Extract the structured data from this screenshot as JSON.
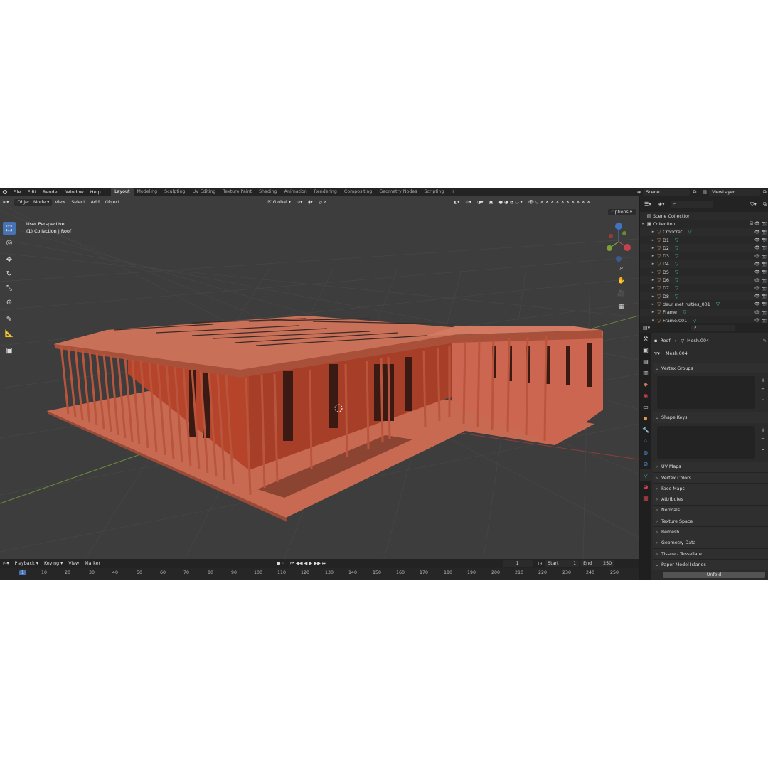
{
  "topbar": {
    "menu": [
      "File",
      "Edit",
      "Render",
      "Window",
      "Help"
    ],
    "workspace_tabs": [
      "Layout",
      "Modeling",
      "Sculpting",
      "UV Editing",
      "Texture Paint",
      "Shading",
      "Animation",
      "Rendering",
      "Compositing",
      "Geometry Nodes",
      "Scripting"
    ],
    "active_tab": "Layout",
    "add_tab": "+",
    "scene": "Scene",
    "view_layer": "ViewLayer"
  },
  "viewport": {
    "mode": "Object Mode",
    "menu": [
      "View",
      "Select",
      "Add",
      "Object"
    ],
    "orientation": "Global",
    "options_label": "Options",
    "info_line1": "User Perspective",
    "info_line2": "(1) Collection | Roof"
  },
  "timeline": {
    "menu": [
      "Playback",
      "Keying",
      "View",
      "Marker"
    ],
    "current_frame": "1",
    "start_label": "Start",
    "start": "1",
    "end_label": "End",
    "end": "250",
    "ruler": [
      "1",
      "10",
      "20",
      "30",
      "40",
      "50",
      "60",
      "70",
      "80",
      "90",
      "100",
      "110",
      "120",
      "130",
      "140",
      "150",
      "160",
      "170",
      "180",
      "190",
      "200",
      "210",
      "220",
      "230",
      "240",
      "250"
    ]
  },
  "outliner": {
    "scene_collection": "Scene Collection",
    "collection": "Collection",
    "objects": [
      "Croncret",
      "D1",
      "D2",
      "D3",
      "D4",
      "D5",
      "D6",
      "D7",
      "D8",
      "deur met ruitjes_001",
      "Frame",
      "Frame.001"
    ]
  },
  "properties": {
    "object_name": "Roof",
    "mesh_name": "Mesh.004",
    "data_field": "Mesh.004",
    "panels": [
      "Vertex Groups",
      "Shape Keys",
      "UV Maps",
      "Vertex Colors",
      "Face Maps",
      "Attributes",
      "Normals",
      "Texture Space",
      "Remesh",
      "Geometry Data",
      "Tissue - Tessellate",
      "Paper Model Islands"
    ],
    "unfold_button": "Unfold"
  },
  "colors": {
    "accent": "#4772b3",
    "model": "#c25a40",
    "mesh_icon": "#3fc0a0",
    "object_icon": "#e89a4a"
  }
}
